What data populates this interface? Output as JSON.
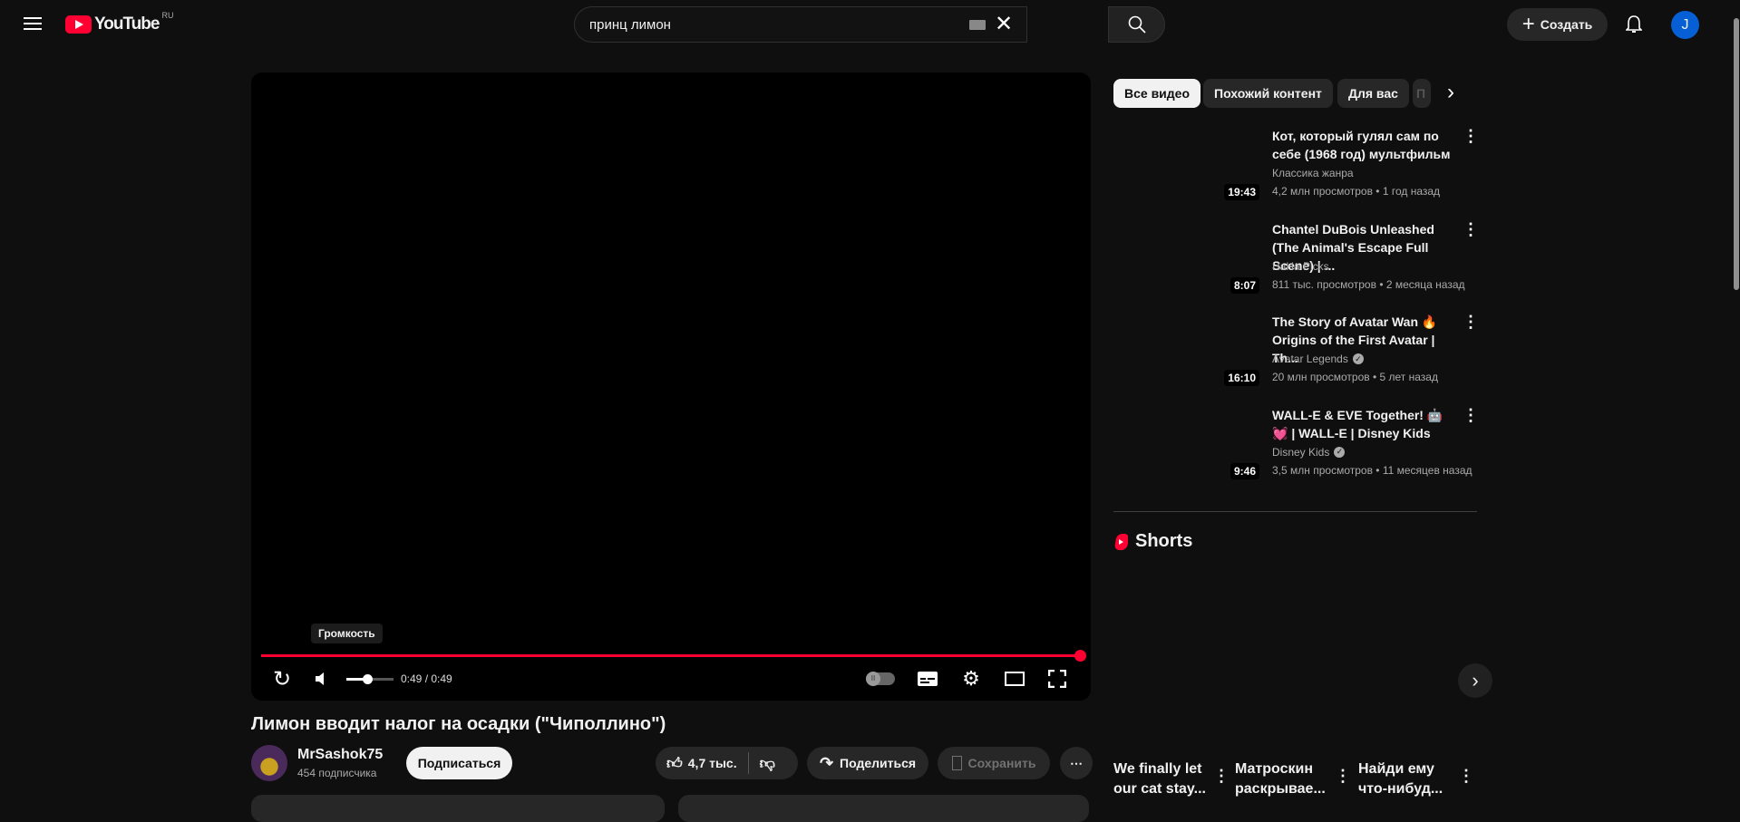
{
  "header": {
    "logo": "YouTube",
    "region": "RU",
    "search_value": "принц лимон",
    "create_label": "Создать",
    "avatar_letter": "J"
  },
  "player": {
    "tooltip": "Громкость",
    "time": "0:49 / 0:49",
    "progress": 1.0,
    "volume": 0.45
  },
  "video": {
    "title": "Лимон вводит налог на осадки (\"Чиполлино\")",
    "channel": "MrSashok75",
    "subscribers": "454 подписчика",
    "subscribe_label": "Подписаться",
    "likes": "4,7 тыс.",
    "share_label": "Поделиться",
    "save_label": "Сохранить"
  },
  "chips": [
    "Все видео",
    "Похожий контент",
    "Для вас",
    "П"
  ],
  "recommendations": [
    {
      "title": "Кот, который гулял сам по себе (1968 год) мультфильм",
      "channel": "Классика жанра",
      "verified": false,
      "meta": "4,2 млн просмотров • 1 год назад",
      "duration": "19:43"
    },
    {
      "title": "Chantel DuBois Unleashed (The Animal's Escape Full Scene) | ...",
      "channel": "HaHa Picks",
      "verified": false,
      "meta": "811 тыс. просмотров • 2 месяца назад",
      "duration": "8:07"
    },
    {
      "title": "The Story of Avatar Wan 🔥 Origins of the First Avatar | Th...",
      "channel": "Avatar Legends",
      "verified": true,
      "meta": "20 млн просмотров • 5 лет назад",
      "duration": "16:10"
    },
    {
      "title": "WALL-E & EVE Together! 🤖 💓 | WALL-E | Disney Kids",
      "channel": "Disney Kids",
      "verified": true,
      "meta": "3,5 млн просмотров • 11 месяцев назад",
      "duration": "9:46"
    }
  ],
  "shorts": {
    "heading": "Shorts",
    "items": [
      {
        "title": "We finally let our cat stay..."
      },
      {
        "title": "Матроскин раскрывае..."
      },
      {
        "title": "Найди ему что-нибуд..."
      }
    ]
  },
  "colors": {
    "accent": "#ff0033",
    "bg": "#0f0f0f",
    "chip": "#272727"
  }
}
